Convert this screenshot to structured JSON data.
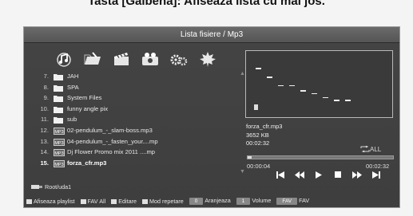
{
  "caption": "Tasta [Galbena]: Afiseaza lista cu mai jos.",
  "window": {
    "title": "Lista fisiere / Mp3"
  },
  "toolbar_icons": [
    "music-note-icon",
    "folder-open-icon",
    "video-film-icon",
    "camera-icon",
    "settings-gears-icon",
    "maple-leaf-icon"
  ],
  "files": [
    {
      "num": "7.",
      "label": "JAH",
      "kind": "folder"
    },
    {
      "num": "8.",
      "label": "SPA",
      "kind": "folder"
    },
    {
      "num": "9.",
      "label": "System Files",
      "kind": "folder"
    },
    {
      "num": "10.",
      "label": "funny angle pix",
      "kind": "folder"
    },
    {
      "num": "11.",
      "label": "sub",
      "kind": "folder"
    },
    {
      "num": "12.",
      "label": "02-pendulum_-_slam-boss.mp3",
      "kind": "mp3"
    },
    {
      "num": "13.",
      "label": "04-pendulum_-_fasten_your....mp",
      "kind": "mp3"
    },
    {
      "num": "14.",
      "label": "Dj Flower Promo mix 2011 ....mp",
      "kind": "mp3"
    },
    {
      "num": "15.",
      "label": "forza_cfr.mp3",
      "kind": "mp3",
      "selected": true
    }
  ],
  "file_type_label": "MP3",
  "root_path": "Root/uda1",
  "track": {
    "name": "forza_cfr.mp3",
    "size": "3652 KB",
    "duration": "00:02:32",
    "elapsed": "00:00:04",
    "total": "00:02:32",
    "progress": 0.03,
    "repeat": "ALL"
  },
  "visualizer_levels": [
    0.75,
    0.62,
    0.5,
    0.5,
    0.42,
    0.38,
    0.32,
    0.28,
    0.28
  ],
  "legend": [
    {
      "swatch": true,
      "label": "Afiseaza playlist"
    },
    {
      "swatch": true,
      "label": "FAV All"
    },
    {
      "swatch": true,
      "label": "Editare"
    },
    {
      "swatch": true,
      "label": "Mod repetare"
    },
    {
      "key": "0",
      "label": "Aranjeaza"
    },
    {
      "key": "1",
      "label": "Volume"
    },
    {
      "key": "FAV",
      "label": "FAV"
    }
  ]
}
